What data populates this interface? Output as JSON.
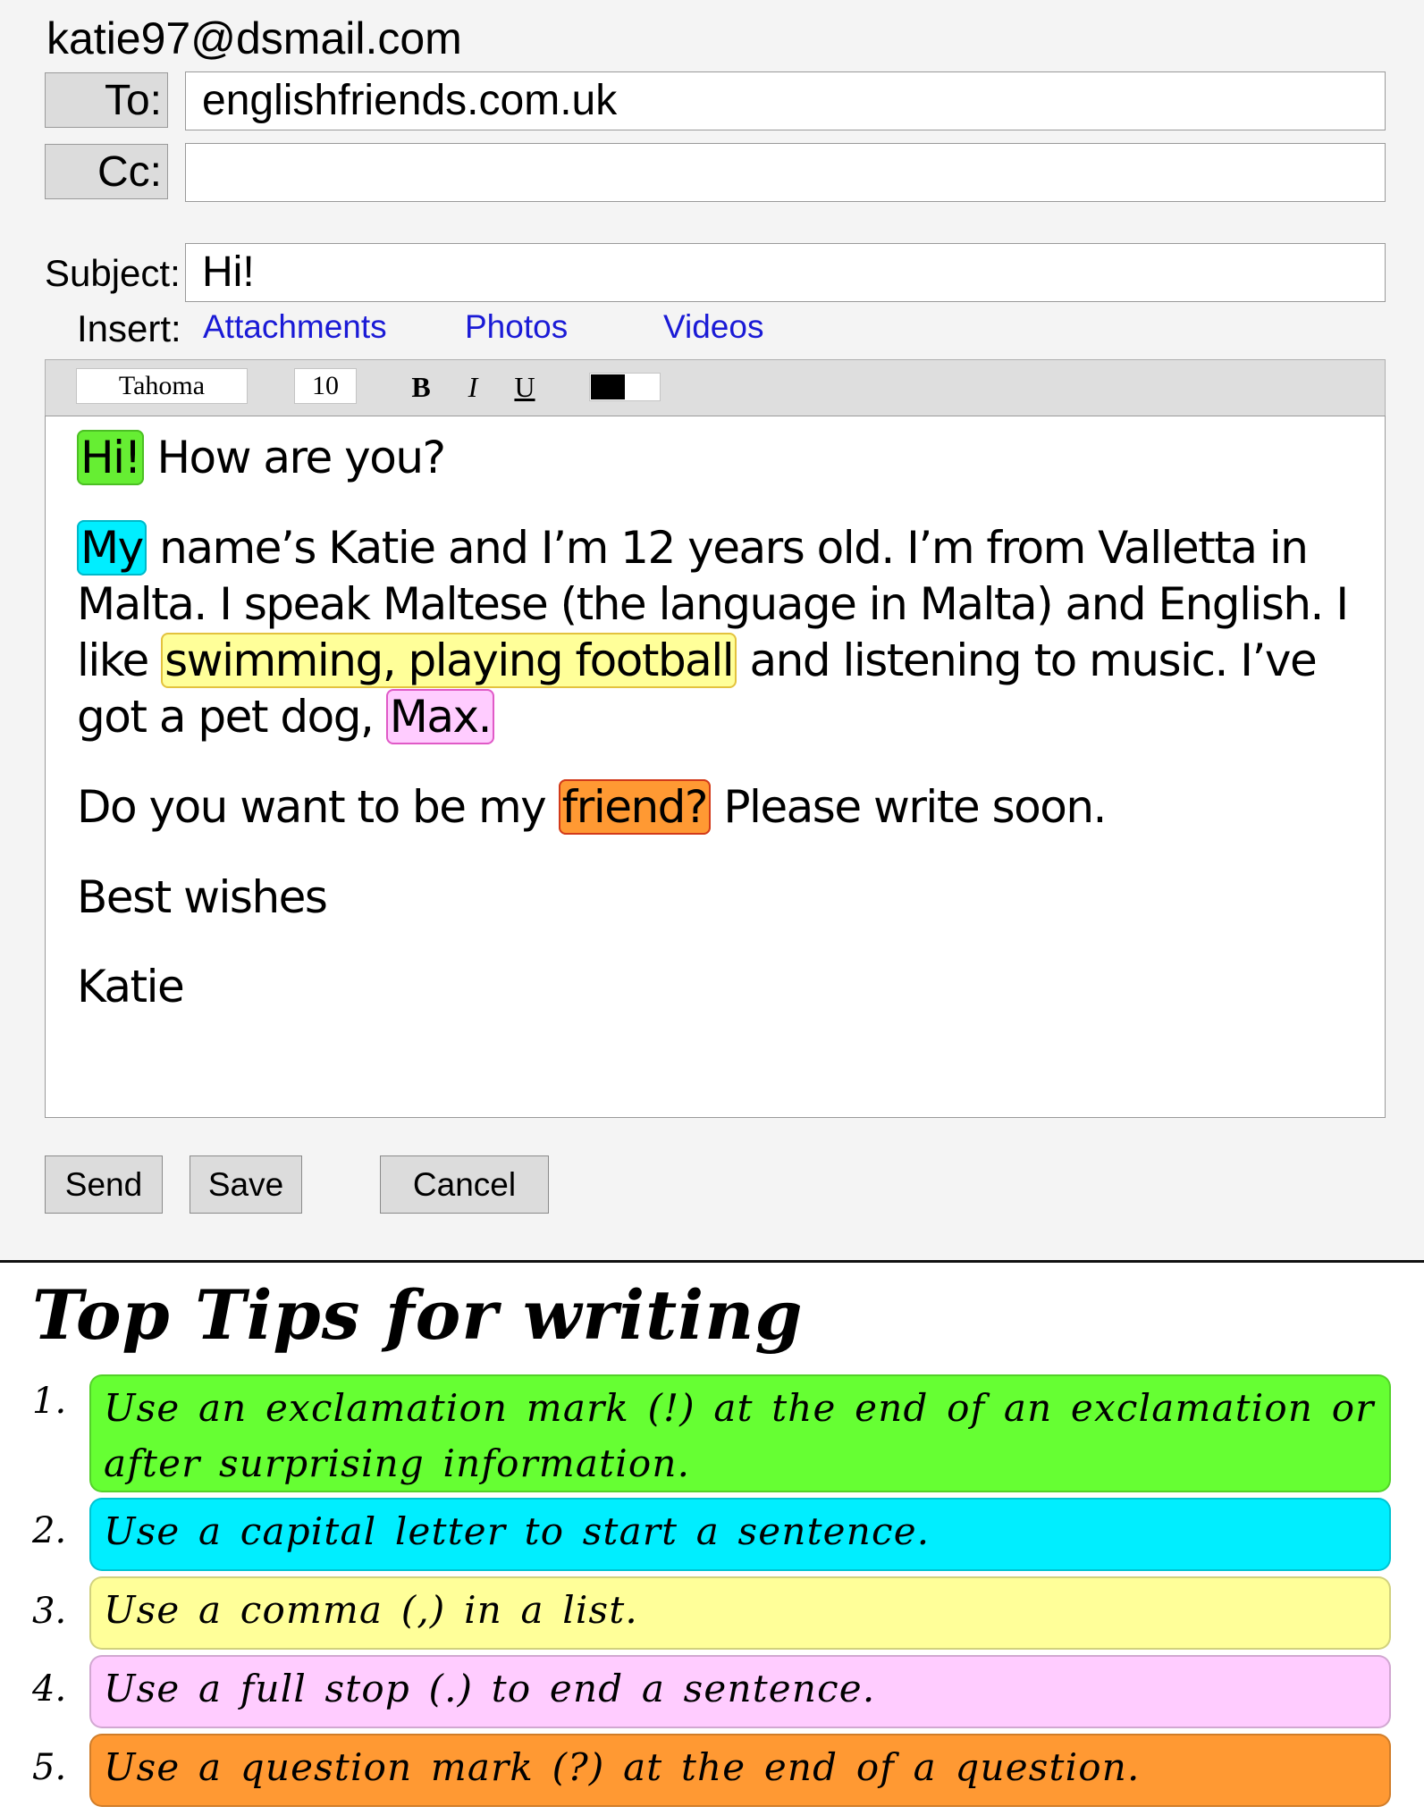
{
  "email": {
    "from": "katie97@dsmail.com",
    "to_label": "To:",
    "to_value": "englishfriends.com.uk",
    "cc_label": "Cc:",
    "cc_value": "",
    "subject_label": "Subject:",
    "subject_value": "Hi!",
    "insert_label": "Insert:",
    "insert_links": [
      "Attachments",
      "Photos",
      "Videos"
    ],
    "toolbar": {
      "font": "Tahoma",
      "size": "10",
      "bold": "B",
      "italic": "I",
      "underline": "U",
      "text_color": "#000000"
    },
    "body": {
      "p1_hl": "Hi!",
      "p1_rest": " How are you?",
      "p2_hl1": "My",
      "p2_a": " name’s Katie and I’m 12 years old. I’m from Valletta in Malta. I speak Maltese (the language in Malta) and English. I like ",
      "p2_hl2": "swimming, playing football",
      "p2_b": " and listening to music. I’ve got a pet dog, ",
      "p2_hl3": "Max.",
      "p3_a": "Do you want to be my ",
      "p3_hl": "friend?",
      "p3_b": " Please write soon.",
      "p4": "Best wishes",
      "p5": "Katie"
    },
    "buttons": {
      "send": "Send",
      "save": "Save",
      "cancel": "Cancel"
    }
  },
  "tips": {
    "title": "Top Tips for writing",
    "items": [
      {
        "num": "1.",
        "text": "Use an exclamation mark (!) at the end of an exclamation or after surprising information.",
        "color": "#66ff33"
      },
      {
        "num": "2.",
        "text": "Use a capital letter to start a sentence.",
        "color": "#00eeff"
      },
      {
        "num": "3.",
        "text": "Use a comma (,) in a list.",
        "color": "#ffff99"
      },
      {
        "num": "4.",
        "text": "Use a full stop (.) to end a sentence.",
        "color": "#ffccff"
      },
      {
        "num": "5.",
        "text": "Use a question mark (?) at the end of a question.",
        "color": "#ff9933"
      }
    ]
  }
}
